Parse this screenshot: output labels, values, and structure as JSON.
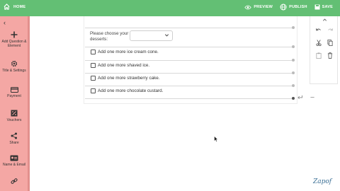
{
  "topbar": {
    "home_label": "HOME",
    "preview_label": "PREVIEW",
    "publish_label": "PUBLISH",
    "save_label": "SAVE"
  },
  "sidebar": {
    "collapse_icon": "chevron-left-icon",
    "items": [
      {
        "label": "Add Question & Element",
        "icon": "plus-icon"
      },
      {
        "label": "Title & Settings",
        "icon": "gear-icon"
      },
      {
        "label": "Payment",
        "icon": "credit-card-icon"
      },
      {
        "label": "Vouchers",
        "icon": "voucher-icon"
      },
      {
        "label": "Share",
        "icon": "share-icon"
      },
      {
        "label": "Name & Email",
        "icon": "id-card-icon"
      },
      {
        "label": "",
        "icon": "link-icon"
      }
    ]
  },
  "question": {
    "label": "Please choose your desserts:",
    "dropdown_value": ""
  },
  "options": [
    {
      "label": "Add one more ice cream cone."
    },
    {
      "label": "Add one more shaved ice."
    },
    {
      "label": "Add one more strawberry cake."
    },
    {
      "label": "Add one more chocolate custard."
    }
  ],
  "tools": [
    "chevron-up-icon",
    "undo-icon",
    "redo-icon",
    "scissors-icon",
    "copy-icon",
    "paste-icon",
    "trash-icon"
  ],
  "brand": {
    "logo_text": "Zapof"
  },
  "colors": {
    "topbar": "#63bf74",
    "sidebar": "#f4a7a4"
  }
}
